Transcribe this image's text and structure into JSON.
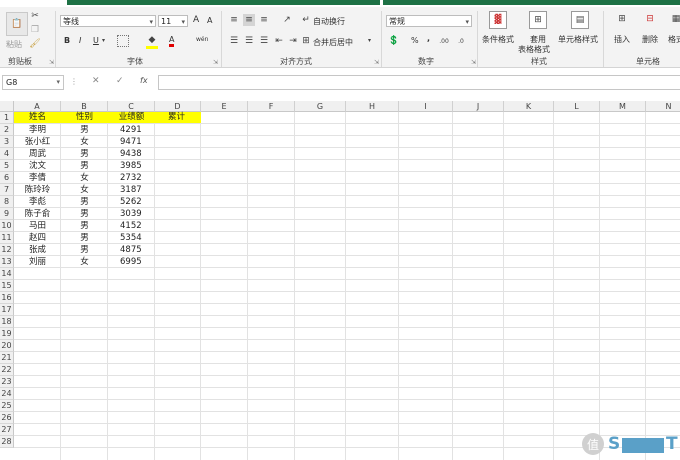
{
  "ribbon": {
    "clipboard": {
      "paste_label": "粘贴",
      "group_label": "剪贴板"
    },
    "font": {
      "font_name": "等线",
      "font_size": "11",
      "bold": "B",
      "italic": "I",
      "underline": "U",
      "grow": "A",
      "shrink": "A",
      "font_color_glyph": "A",
      "phonetic_glyph": "wén",
      "group_label": "字体"
    },
    "alignment": {
      "wrap_text": "自动换行",
      "merge_center": "合并后居中",
      "group_label": "对齐方式"
    },
    "number": {
      "format": "常规",
      "percent": "%",
      "comma": ",",
      "group_label": "数字"
    },
    "styles": {
      "conditional": "条件格式",
      "table_format_1": "套用",
      "table_format_2": "表格格式",
      "cell_styles": "单元格样式",
      "group_label": "样式"
    },
    "cells": {
      "insert": "插入",
      "delete": "删除",
      "format": "格式",
      "group_label": "单元格"
    }
  },
  "formula_bar": {
    "name_box": "G8",
    "fx": "fx",
    "value": ""
  },
  "sheet": {
    "columns": [
      "A",
      "B",
      "C",
      "D",
      "E",
      "F",
      "G",
      "H",
      "I",
      "J",
      "K",
      "L",
      "M",
      "N"
    ],
    "row_count": 28,
    "header_row": [
      "姓名",
      "性别",
      "业绩额",
      "累计"
    ],
    "rows": [
      [
        "李明",
        "男",
        "4291"
      ],
      [
        "张小红",
        "女",
        "9471"
      ],
      [
        "周武",
        "男",
        "9438"
      ],
      [
        "沈文",
        "男",
        "3985"
      ],
      [
        "李倩",
        "女",
        "2732"
      ],
      [
        "陈玲玲",
        "女",
        "3187"
      ],
      [
        "李彪",
        "男",
        "5262"
      ],
      [
        "陈子俞",
        "男",
        "3039"
      ],
      [
        "马田",
        "男",
        "4152"
      ],
      [
        "赵四",
        "男",
        "5354"
      ],
      [
        "张成",
        "男",
        "4875"
      ],
      [
        "刘丽",
        "女",
        "6995"
      ]
    ],
    "header_fill": "#ffff00"
  },
  "watermark": {
    "glyph": "值",
    "text": "S",
    "text_tail": "T"
  }
}
